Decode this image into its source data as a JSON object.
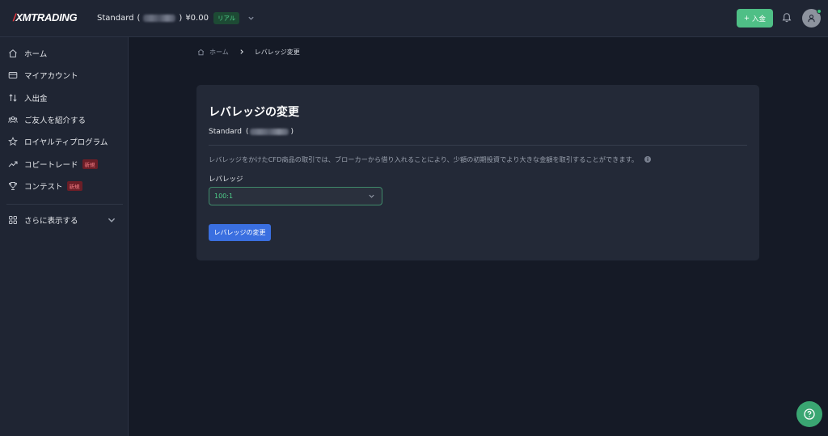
{
  "header": {
    "logo_text": "XMTRADING",
    "account_type": "Standard",
    "account_paren_open": "(",
    "account_paren_close": ")",
    "balance": "¥0.00",
    "account_mode": "リアル",
    "deposit_label": "入金"
  },
  "sidebar": {
    "items": [
      {
        "label": "ホーム",
        "icon": "home-icon"
      },
      {
        "label": "マイアカウント",
        "icon": "card-icon"
      },
      {
        "label": "入出金",
        "icon": "transfer-arrows-icon"
      },
      {
        "label": "ご友人を紹介する",
        "icon": "users-icon"
      },
      {
        "label": "ロイヤルティプログラム",
        "icon": "star-icon"
      },
      {
        "label": "コピートレード",
        "icon": "trend-up-icon",
        "badge": "新規"
      },
      {
        "label": "コンテスト",
        "icon": "trophy-icon",
        "badge": "新規"
      }
    ],
    "more_label": "さらに表示する"
  },
  "breadcrumb": {
    "home": "ホーム",
    "current": "レバレッジ変更"
  },
  "card": {
    "title": "レバレッジの変更",
    "account_type": "Standard",
    "account_paren_open": "(",
    "account_paren_close": ")",
    "description": "レバレッジをかけたCFD商品の取引では、ブローカーから借り入れることにより、少額の初期投資でより大きな金額を取引することができます。",
    "leverage_label": "レバレッジ",
    "leverage_value": "100:1",
    "submit_label": "レバレッジの変更"
  },
  "colors": {
    "accent_green": "#4fbf86",
    "primary_blue": "#3a6fe0",
    "new_badge": "#6b1e27"
  }
}
